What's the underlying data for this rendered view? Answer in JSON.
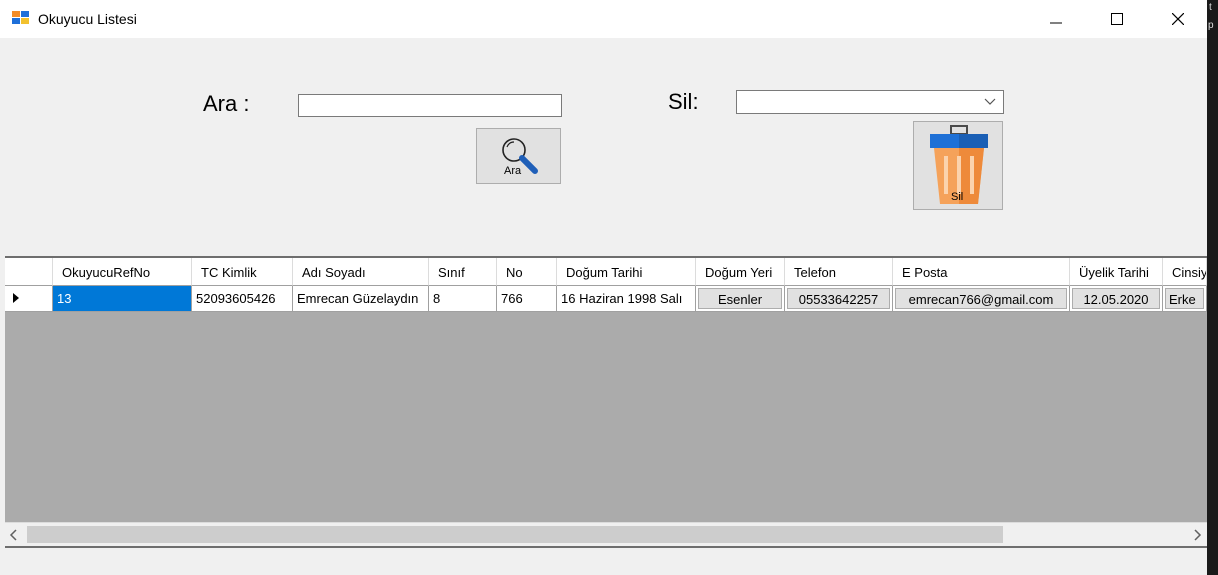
{
  "window": {
    "title": "Okuyucu Listesi"
  },
  "search": {
    "label": "Ara :",
    "value": "",
    "button_caption": "Ara"
  },
  "delete": {
    "label": "Sil:",
    "selected": "",
    "button_caption": "Sil"
  },
  "grid": {
    "columns": [
      "OkuyucuRefNo",
      "TC Kimlik",
      "Adı Soyadı",
      "Sınıf",
      "No",
      "Doğum Tarihi",
      "Doğum Yeri",
      "Telefon",
      "E Posta",
      "Üyelik Tarihi",
      "Cinsiy"
    ],
    "rows": [
      [
        "13",
        "52093605426",
        "Emrecan Güzelaydın",
        "8",
        "766",
        "16 Haziran 1998 Salı",
        "Esenler",
        "05533642257",
        "emrecan766@gmail.com",
        "12.05.2020",
        "Erke"
      ]
    ]
  },
  "side_strip": {
    "chars": [
      "t",
      "p"
    ]
  },
  "colors": {
    "selection": "#0078d7",
    "grid_background": "#ababab",
    "window_background": "#f0f0f0"
  }
}
